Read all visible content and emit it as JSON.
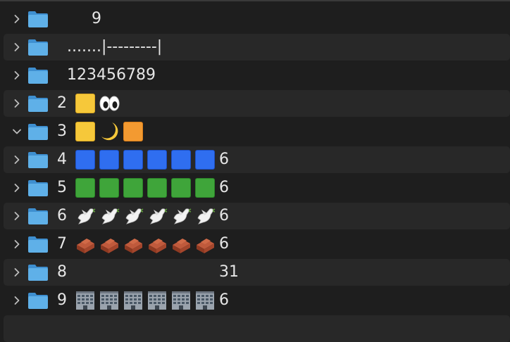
{
  "rows": [
    {
      "id": "r1",
      "chevron": "right",
      "name": "       9",
      "emojis": [],
      "count": ""
    },
    {
      "id": "r2",
      "chevron": "right",
      "name": "  .......|---------|",
      "emojis": [],
      "count": ""
    },
    {
      "id": "r3",
      "chevron": "right",
      "name": "  123456789",
      "emojis": [],
      "count": ""
    },
    {
      "id": "r4",
      "chevron": "right",
      "name": "2",
      "emojis": [
        "yellow-square",
        "eyes"
      ],
      "count": ""
    },
    {
      "id": "r5",
      "chevron": "down",
      "name": "3",
      "emojis": [
        "yellow-square",
        "crescent-moon",
        "orange-square"
      ],
      "count": ""
    },
    {
      "id": "r6",
      "chevron": "right",
      "name": "4",
      "emojis": [
        "blue-square",
        "blue-square",
        "blue-square",
        "blue-square",
        "blue-square",
        "blue-square"
      ],
      "count": "6"
    },
    {
      "id": "r7",
      "chevron": "right",
      "name": "5",
      "emojis": [
        "green-square",
        "green-square",
        "green-square",
        "green-square",
        "green-square",
        "green-square"
      ],
      "count": "6"
    },
    {
      "id": "r8",
      "chevron": "right",
      "name": "6",
      "emojis": [
        "dove",
        "dove",
        "dove",
        "dove",
        "dove",
        "dove"
      ],
      "count": "6"
    },
    {
      "id": "r9",
      "chevron": "right",
      "name": "7",
      "emojis": [
        "brick",
        "brick",
        "brick",
        "brick",
        "brick",
        "brick"
      ],
      "count": "6"
    },
    {
      "id": "r10",
      "chevron": "right",
      "name": "8",
      "emojis": [],
      "count": "31"
    },
    {
      "id": "r11",
      "chevron": "right",
      "name": "9",
      "emojis": [
        "office-building",
        "office-building",
        "office-building",
        "office-building",
        "office-building",
        "office-building"
      ],
      "count": "6"
    }
  ],
  "colors": {
    "folder": "#5fb0e8",
    "folder_dark": "#3e8fd0",
    "chevron": "#bdbdbd"
  }
}
